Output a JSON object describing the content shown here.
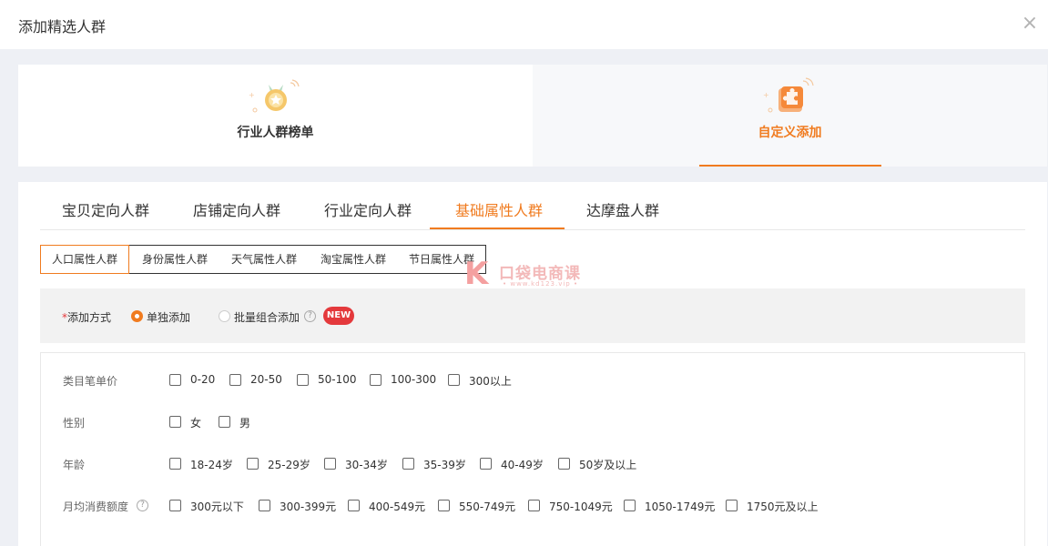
{
  "dialog": {
    "title": "添加精选人群",
    "close_icon": "×"
  },
  "modes": [
    {
      "label": "行业人群榜单",
      "icon": "medal-icon",
      "active": false
    },
    {
      "label": "自定义添加",
      "icon": "puzzle-icon",
      "active": true
    }
  ],
  "tabs": [
    "宝贝定向人群",
    "店铺定向人群",
    "行业定向人群",
    "基础属性人群",
    "达摩盘人群"
  ],
  "active_tab": "基础属性人群",
  "subtabs": [
    "人口属性人群",
    "身份属性人群",
    "天气属性人群",
    "淘宝属性人群",
    "节日属性人群"
  ],
  "active_subtab": "人口属性人群",
  "watermark": {
    "name": "口袋电商课",
    "url": "• www.kd123.vip •"
  },
  "add_method": {
    "required_mark": "*",
    "label": "添加方式",
    "options": [
      {
        "label": "单独添加",
        "checked": true
      },
      {
        "label": "批量组合添加",
        "checked": false
      }
    ],
    "help_icon": "?",
    "badge": "NEW"
  },
  "attributes": [
    {
      "label": "类目笔单价",
      "options": [
        "0-20",
        "20-50",
        "50-100",
        "100-300",
        "300以上"
      ]
    },
    {
      "label": "性别",
      "options": [
        "女",
        "男"
      ]
    },
    {
      "label": "年龄",
      "options": [
        "18-24岁",
        "25-29岁",
        "30-34岁",
        "35-39岁",
        "40-49岁",
        "50岁及以上"
      ]
    },
    {
      "label": "月均消费额度",
      "help_icon": "?",
      "options": [
        "300元以下",
        "300-399元",
        "400-549元",
        "550-749元",
        "750-1049元",
        "1050-1749元",
        "1750元及以上"
      ]
    }
  ],
  "colors": {
    "accent": "#f07b1f",
    "badge": "#e4393c"
  }
}
